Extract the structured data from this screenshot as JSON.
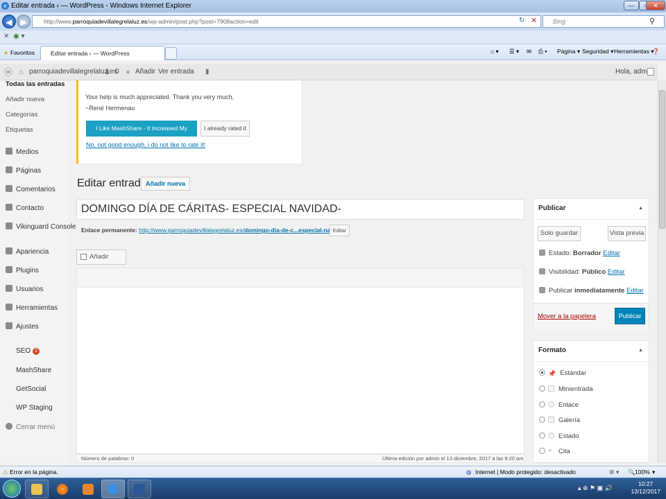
{
  "browser": {
    "window_title": "Editar entrada ‹ — WordPress - Windows Internet Explorer",
    "address_prefix": "http://www.",
    "address_domain": "parroquiadevillalegrelaluz.es",
    "address_rest": "/wp-admin/post.php?post=7908action=edit",
    "search_placeholder": "Bing",
    "favorites_label": "Favoritos",
    "tab_label": "Editar entrada ‹ — WordPress",
    "cmd_page": "Página ▾",
    "cmd_security": "Seguridad ▾",
    "cmd_tools": "Herramientas ▾",
    "status_error": "Error en la página.",
    "status_zone": "Internet | Modo protegido: desactivado",
    "zoom": "100%"
  },
  "adminbar": {
    "site_name": "parroquiadevillalegrelaluz.es",
    "comments_count": "0",
    "new_label": "Añadir",
    "view_label": "Ver entrada",
    "greeting": "Hola, admin"
  },
  "sidebar": {
    "submenu": [
      "Todas las entradas",
      "Añadir nueva",
      "Categorías",
      "Etiquetas"
    ],
    "items": [
      "Medios",
      "Páginas",
      "Comentarios",
      "Contacto",
      "Vikinguard Console",
      "Apariencia",
      "Plugins",
      "Usuarios",
      "Herramientas",
      "Ajustes"
    ],
    "plugins": [
      "SEO",
      "MashShare",
      "GetSocial",
      "WP Staging"
    ],
    "seo_badge": "2",
    "collapse": "Cerrar menú"
  },
  "notice": {
    "line1": "Your help is much appreciated. Thank you very much,",
    "line2": "~René Hermenau",
    "btn_like": "I Like MashShare - It Increased My Shares",
    "btn_rated": "I already rated it",
    "link_not": "No, not good enough, i do not like to rate it!"
  },
  "editor": {
    "page_title": "Editar entrada",
    "add_new": "Añadir nueva",
    "post_title": "DOMINGO DÍA DE CÁRITAS- ESPECIAL NAVIDAD-",
    "permalink_label": "Enlace permanente:",
    "permalink_base": "http://www.parroquiadevillalegrelaluz.es/",
    "permalink_slug": "domingo-dia-de-c...especial-navidad",
    "permalink_end": "/",
    "edit_permalink": "Editar",
    "add_media": "Añadir objeto",
    "word_count": "Número de palabras: 0",
    "last_edit": "Última edición por admin el 13 diciembre, 2017 a las 9:20 am"
  },
  "publish_box": {
    "title": "Publicar",
    "save_draft": "Solo guardar",
    "preview": "Vista previa",
    "status_label": "Estado:",
    "status_value": "Borrador",
    "visibility_label": "Visibilidad:",
    "visibility_value": "Público",
    "publish_label": "Publicar",
    "publish_value": "inmediatamente",
    "edit": "Editar",
    "trash": "Mover a la papelera",
    "publish_btn": "Publicar"
  },
  "format_box": {
    "title": "Formato",
    "options": [
      "Estándar",
      "Minientrada",
      "Enlace",
      "Galería",
      "Estado",
      "Cita"
    ],
    "selected": 0
  },
  "taskbar": {
    "time": "10:27",
    "date": "13/12/2017"
  }
}
